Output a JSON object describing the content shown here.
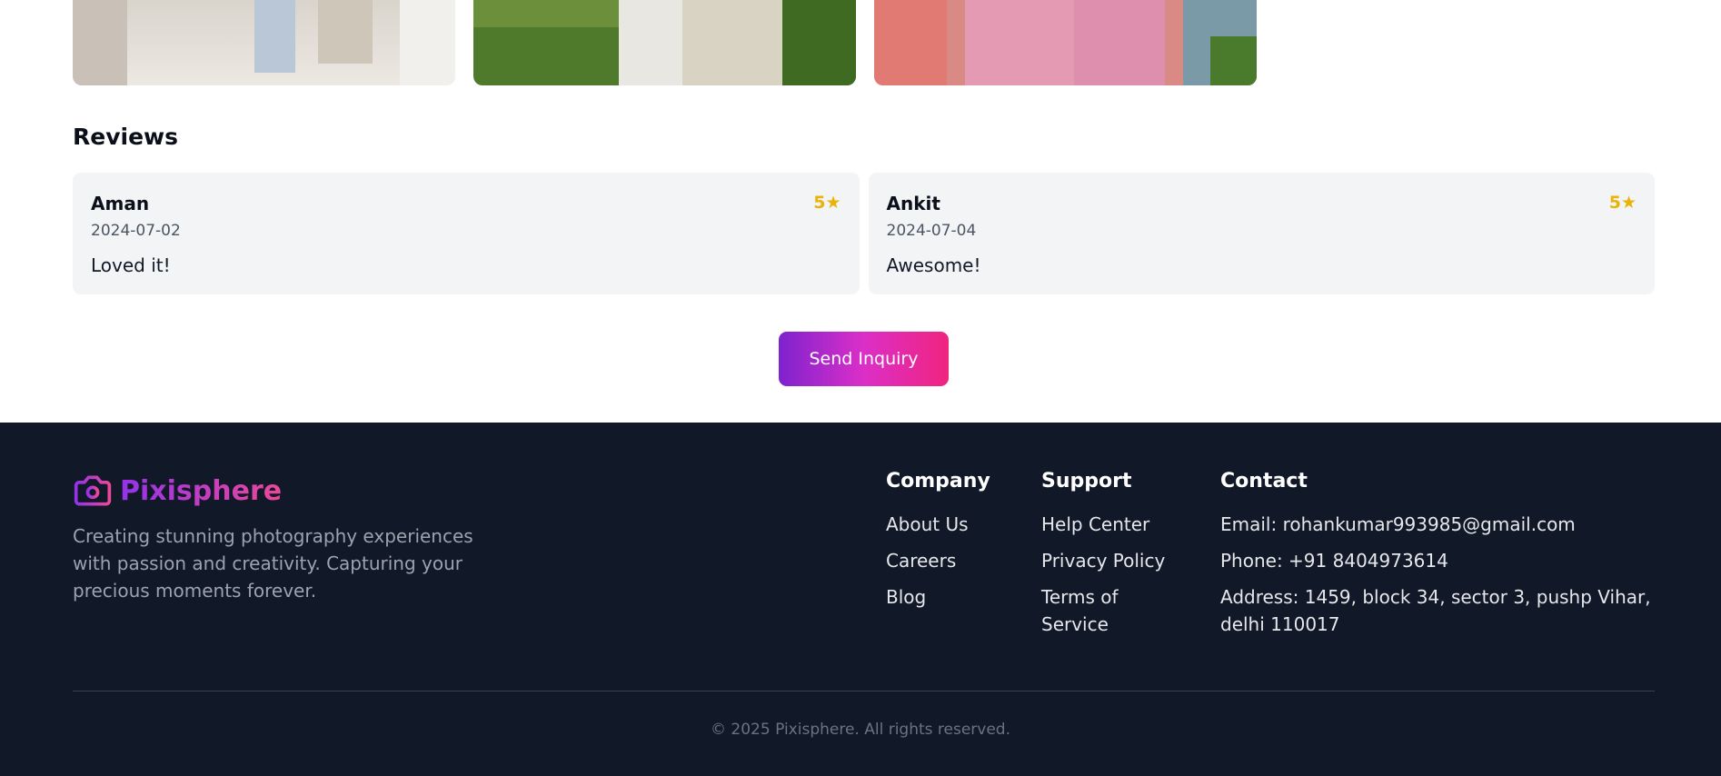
{
  "reviews": {
    "title": "Reviews",
    "items": [
      {
        "name": "Aman",
        "date": "2024-07-02",
        "text": "Loved it!",
        "rating": "5★"
      },
      {
        "name": "Ankit",
        "date": "2024-07-04",
        "text": "Awesome!",
        "rating": "5★"
      }
    ]
  },
  "inquiry": {
    "label": "Send Inquiry"
  },
  "footer": {
    "brand": "Pixisphere",
    "tagline": "Creating stunning photography experiences with passion and creativity. Capturing your precious moments forever.",
    "company": {
      "title": "Company",
      "items": [
        "About Us",
        "Careers",
        "Blog"
      ]
    },
    "support": {
      "title": "Support",
      "items": [
        "Help Center",
        "Privacy Policy",
        "Terms of Service"
      ]
    },
    "contact": {
      "title": "Contact",
      "email": "Email: rohankumar993985@gmail.com",
      "phone": "Phone: +91 8404973614",
      "address": "Address: 1459, block 34, sector 3, pushp Vihar, delhi 110017"
    },
    "copyright": "© 2025 Pixisphere. All rights reserved."
  },
  "colors": {
    "footer_bg": "#111827",
    "rating": "#eab308",
    "brand_gradient_start": "#9333ea",
    "brand_gradient_end": "#ec4899"
  },
  "icons": {
    "brand": "camera-icon"
  }
}
